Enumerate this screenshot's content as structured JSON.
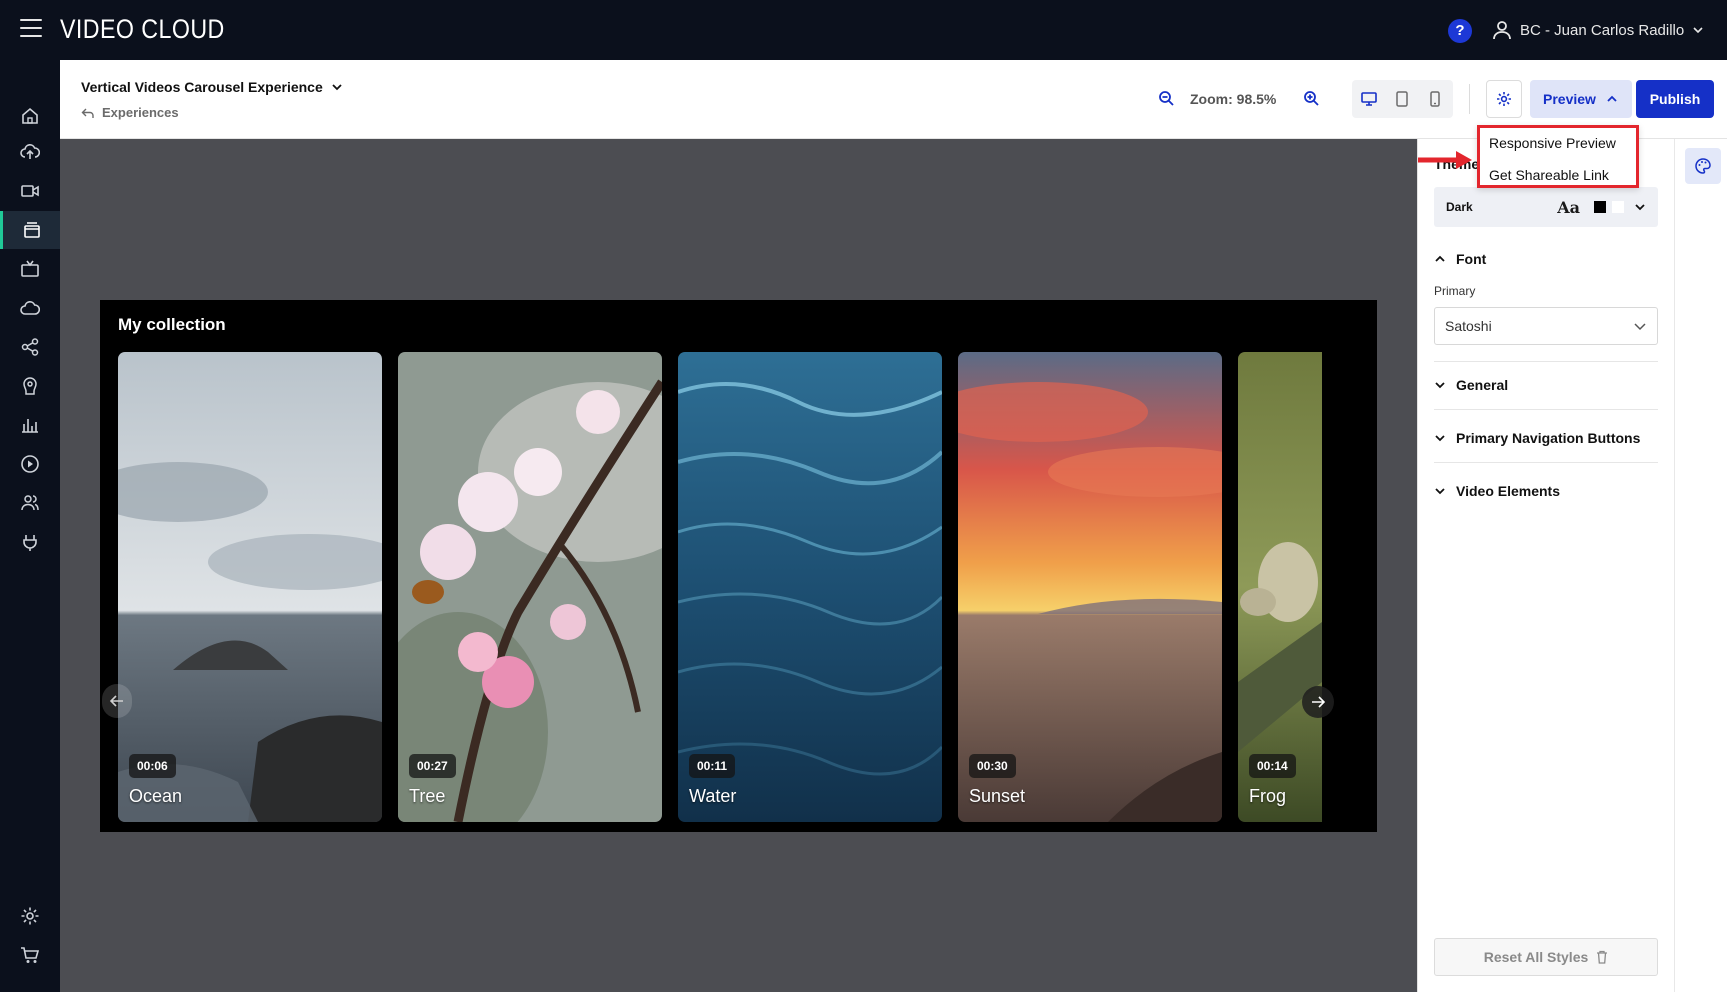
{
  "app": {
    "logo": "VIDEO CLOUD",
    "help_label": "?",
    "user_name": "BC - Juan Carlos Radillo"
  },
  "rail": {
    "items": [
      "home-icon",
      "upload-icon",
      "video-icon",
      "experiences-icon",
      "tv-icon",
      "cloud-icon",
      "share-icon",
      "audience-icon",
      "analytics-icon",
      "player-icon",
      "users-icon",
      "plugin-icon",
      "settings-icon",
      "cart-icon"
    ],
    "active": "experiences-icon",
    "accent": "#20c997"
  },
  "header": {
    "title": "Vertical Videos Carousel Experience",
    "breadcrumb": "Experiences",
    "zoom": "Zoom: 98.5%",
    "preview_label": "Preview",
    "publish_label": "Publish"
  },
  "preview_menu": {
    "items": [
      "Responsive Preview",
      "Get Shareable Link"
    ]
  },
  "carousel": {
    "title": "My collection",
    "cards": [
      {
        "name": "Ocean",
        "duration": "00:06"
      },
      {
        "name": "Tree",
        "duration": "00:27"
      },
      {
        "name": "Water",
        "duration": "00:11"
      },
      {
        "name": "Sunset",
        "duration": "00:30"
      },
      {
        "name": "Frog",
        "duration": "00:14"
      }
    ]
  },
  "panel": {
    "theme_label": "Theme",
    "theme": {
      "name": "Dark",
      "sample": "Aa"
    },
    "font_section": "Font",
    "font_primary_label": "Primary",
    "font_primary_value": "Satoshi",
    "sections": [
      "General",
      "Primary Navigation Buttons",
      "Video Elements"
    ],
    "reset_label": "Reset All Styles"
  },
  "colors": {
    "brand_blue": "#1530c7",
    "preview_bg": "#dfe4f8",
    "highlight_red": "#e3262d",
    "topbar_bg": "#0b101c",
    "canvas_bg": "#4c4d52"
  }
}
